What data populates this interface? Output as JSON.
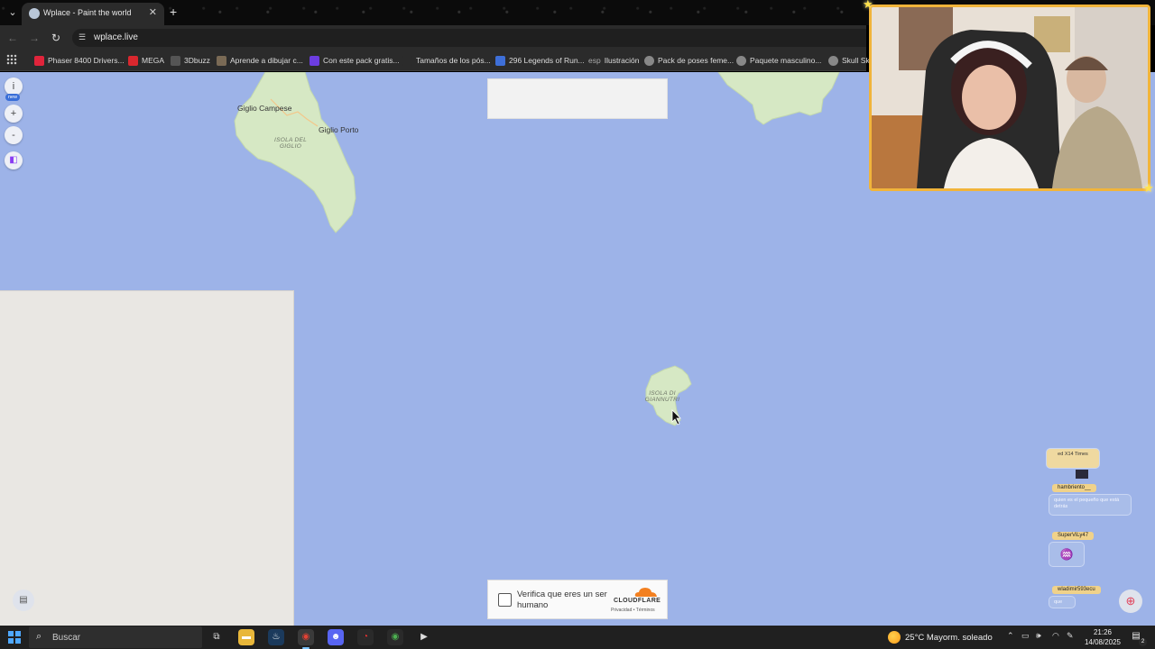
{
  "browser": {
    "tab_title": "Wplace - Paint the world",
    "url": "wplace.live",
    "bookmarks": [
      {
        "label": "Phaser 8400 Drivers...",
        "color": "#e0243b"
      },
      {
        "label": "MEGA",
        "color": "#d9272e"
      },
      {
        "label": "3Dbuzz",
        "color": "#555555"
      },
      {
        "label": "Aprende a dibujar c...",
        "color": "#7a6a55"
      },
      {
        "label": "Con este pack gratis...",
        "color": "#6c3de0"
      },
      {
        "label": "Tamaños de los pós...",
        "color": "#2b2b2b"
      },
      {
        "label": "296 Legends of Run...",
        "color": "#3e6fd8"
      },
      {
        "label": "Ilustración",
        "color": "#2b2b2b"
      },
      {
        "label": "Pack de poses feme...",
        "color": "#888888"
      },
      {
        "label": "Paquete masculino...",
        "color": "#888888"
      },
      {
        "label": "Skull Sk",
        "color": "#888888"
      }
    ],
    "bookmark_esp_text": "esp"
  },
  "map": {
    "labels": {
      "giglio_campese": "Giglio Campese",
      "giglio_porto": "Giglio Porto",
      "isola_del_giglio_1": "ISOLA DEL",
      "isola_del_giglio_2": "GIGLIO",
      "isola_giannutri_1": "ISOLA DI",
      "isola_giannutri_2": "GIANNUTRI"
    },
    "controls": {
      "info": "i",
      "new_badge": "new",
      "zoom_in": "+",
      "zoom_out": "-"
    },
    "colors": {
      "sea": "#9db3e8",
      "land": "#d6e8c4"
    }
  },
  "captcha": {
    "text": "Verifica que eres un ser humano",
    "brand": "CLOUDFLARE",
    "links": "Privacidad • Términos"
  },
  "chat": [
    {
      "user": "",
      "text": "ed X14 Times"
    },
    {
      "user": "hambriento__",
      "text": "quien es el pequeño que está detrás"
    },
    {
      "user": "SuperViLy47",
      "text": ""
    },
    {
      "user": "wladimir593ecu",
      "text": "que"
    }
  ],
  "taskbar": {
    "search_placeholder": "Buscar",
    "weather": "25°C  Mayorm. soleado",
    "time": "21:26",
    "date": "14/08/2025",
    "notification_count": "2"
  }
}
